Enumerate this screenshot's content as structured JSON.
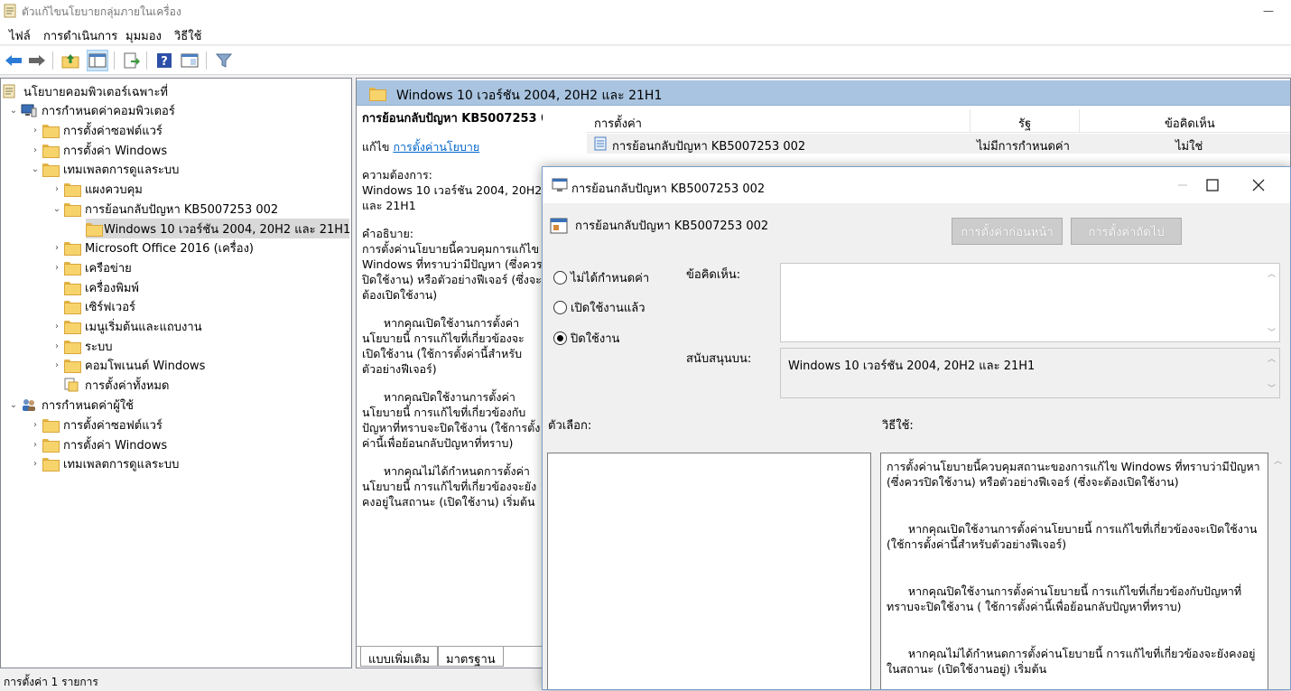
{
  "window": {
    "title": "ตัวแก้ไขนโยบายกลุ่มภายในเครื่อง",
    "minimize_glyph": "—"
  },
  "menu": [
    "ไฟล์",
    "การดำเนินการ",
    "มุมมอง",
    "วิธีใช้"
  ],
  "toolbar": {
    "icons": [
      "back-arrow-icon",
      "forward-arrow-icon",
      "up-folder-icon",
      "show-hide-tree-icon",
      "export-list-icon",
      "help-icon",
      "properties-view-icon",
      "filter-icon"
    ]
  },
  "tree": {
    "root": "นโยบายคอมพิวเตอร์เฉพาะที่",
    "computer_config": "การกำหนดค่าคอมพิวเตอร์",
    "cc_software": "การตั้งค่าซอฟต์แวร์",
    "cc_windows": "การตั้งค่า Windows",
    "cc_admin": "เทมเพลตการดูแลระบบ",
    "at_control_panel": "แผงควบคุม",
    "at_rollback": "การย้อนกลับปัญหา KB5007253 002",
    "at_rollback_child": "Windows 10 เวอร์ชัน 2004, 20H2 และ 21H1",
    "at_office": "Microsoft Office 2016 (เครื่อง)",
    "at_network": "เครือข่าย",
    "at_printers": "เครื่องพิมพ์",
    "at_server": "เซิร์ฟเวอร์",
    "at_start_menu": "เมนูเริ่มต้นและแถบงาน",
    "at_system": "ระบบ",
    "at_windows_components": "คอมโพเนนต์ Windows",
    "at_all_settings": "การตั้งค่าทั้งหมด",
    "user_config": "การกำหนดค่าผู้ใช้",
    "uc_software": "การตั้งค่าซอฟต์แวร์",
    "uc_windows": "การตั้งค่า Windows",
    "uc_admin": "เทมเพลตการดูแลระบบ"
  },
  "right_pane": {
    "header": "Windows 10 เวอร์ชัน 2004, 20H2 และ 21H1",
    "desc_title": "การย้อนกลับปัญหา KB5007253 002",
    "edit_prefix": "แก้ไข ",
    "edit_link": "การตั้งค่านโยบาย",
    "req_label": "ความต้องการ:",
    "req_value": "Windows 10 เวอร์ชัน 2004, 20H2 และ 21H1",
    "desc_label": "คำอธิบาย:",
    "desc_text": "การตั้งค่านโยบายนี้ควบคุมการแก้ไข Windows ที่ทราบว่ามีปัญหา (ซึ่งควรปิดใช้งาน) หรือตัวอย่างฟีเจอร์ (ซึ่งจะต้องเปิดใช้งาน)",
    "desc_p2": "      หากคุณเปิดใช้งานการตั้งค่านโยบายนี้ การแก้ไขที่เกี่ยวข้องจะเปิดใช้งาน (ใช้การตั้งค่านี้สำหรับตัวอย่างฟีเจอร์)",
    "desc_p3": "      หากคุณปิดใช้งานการตั้งค่านโยบายนี้ การแก้ไขที่เกี่ยวข้องกับปัญหาที่ทราบจะปิดใช้งาน (ใช้การตั้งค่านี้เพื่อย้อนกลับปัญหาที่ทราบ)",
    "desc_p4": "      หากคุณไม่ได้กำหนดการตั้งค่านโยบายนี้ การแก้ไขที่เกี่ยวข้องจะยังคงอยู่ในสถานะ (เปิดใช้งาน) เริ่มต้น",
    "columns": [
      "การตั้งค่า",
      "รัฐ",
      "ข้อคิดเห็น"
    ],
    "row": {
      "setting": "การย้อนกลับปัญหา KB5007253 002",
      "state": "ไม่มีการกำหนดค่า",
      "comment": "ไม่ใช่"
    },
    "tabs": [
      "แบบเพิ่มเติม",
      "มาตรฐาน"
    ]
  },
  "status": "การตั้งค่า 1 รายการ",
  "dialog": {
    "title": "การย้อนกลับปัญหา KB5007253 002",
    "subtitle": "การย้อนกลับปัญหา KB5007253 002",
    "prev_button": "การตั้งค่าก่อนหน้า",
    "next_button": "การตั้งค่าถัดไป",
    "radio_not_configured": "ไม่ได้กำหนดค่า",
    "radio_enabled": "เปิดใช้งานแล้ว",
    "radio_disabled": "ปิดใช้งาน",
    "selected": "disabled",
    "comment_label": "ข้อคิดเห็น:",
    "comment_value": "",
    "supported_label": "สนับสนุนบน:",
    "supported_value": "Windows 10 เวอร์ชัน 2004, 20H2 และ 21H1",
    "options_label": "ตัวเลือก:",
    "help_label": "วิธีใช้:",
    "help_p1": "การตั้งค่านโยบายนี้ควบคุมสถานะของการแก้ไข Windows ที่ทราบว่ามีปัญหา (ซึ่งควรปิดใช้งาน) หรือตัวอย่างฟีเจอร์ (ซึ่งจะต้องเปิดใช้งาน)",
    "help_p2": "      หากคุณเปิดใช้งานการตั้งค่านโยบายนี้ การแก้ไขที่เกี่ยวข้องจะเปิดใช้งาน (ใช้การตั้งค่านี้สำหรับตัวอย่างฟีเจอร์)",
    "help_p3": "      หากคุณปิดใช้งานการตั้งค่านโยบายนี้ การแก้ไขที่เกี่ยวข้องกับปัญหาที่ทราบจะปิดใช้งาน ( ใช้การตั้งค่านี้เพื่อย้อนกลับปัญหาที่ทราบ)",
    "help_p4": "      หากคุณไม่ได้กำหนดการตั้งค่านโยบายนี้ การแก้ไขที่เกี่ยวข้องจะยังคงอยู่ในสถานะ (เปิดใช้งานอยู่) เริ่มต้น"
  },
  "colors": {
    "header_blue": "#a9c4e0",
    "link": "#0066cc",
    "folder": "#f7d36c",
    "selected": "#d9d9d9"
  }
}
